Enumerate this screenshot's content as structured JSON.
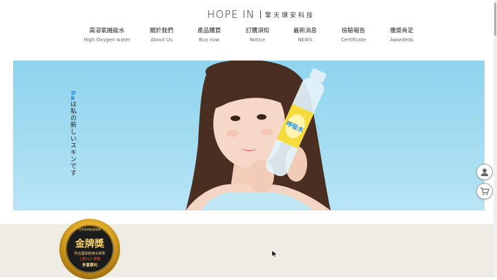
{
  "header": {
    "logo_en": "HOPE IN",
    "logo_cn": "擎天環安科技"
  },
  "nav": [
    {
      "cn": "高溶氧機能水",
      "en": "High Oxygen water"
    },
    {
      "cn": "關於我們",
      "en": "About Us"
    },
    {
      "cn": "產品購買",
      "en": "Buy now"
    },
    {
      "cn": "訂購須知",
      "en": "Notice"
    },
    {
      "cn": "最新消息",
      "en": "NEWS"
    },
    {
      "cn": "檢驗報告",
      "en": "Certificate"
    },
    {
      "cn": "獲獎肯定",
      "en": "Awardeds"
    }
  ],
  "hero": {
    "brand": "ha",
    "tagline": "は私の新しいスキンです",
    "bottle_label": "呼吸水"
  },
  "award": {
    "ring_text": "世界發明創意競賽",
    "title": "金牌獎",
    "line1": "符合國家飲用水標準",
    "line2": "上數ISO 保障",
    "line3": "多重專利"
  },
  "side_buttons": {
    "member_icon": "user-icon",
    "cart_icon": "cart-icon"
  },
  "colors": {
    "sky": "#a3dcf1",
    "brand_blue": "#1e88e5",
    "gold": "#d9a520",
    "cream": "#efece4"
  }
}
